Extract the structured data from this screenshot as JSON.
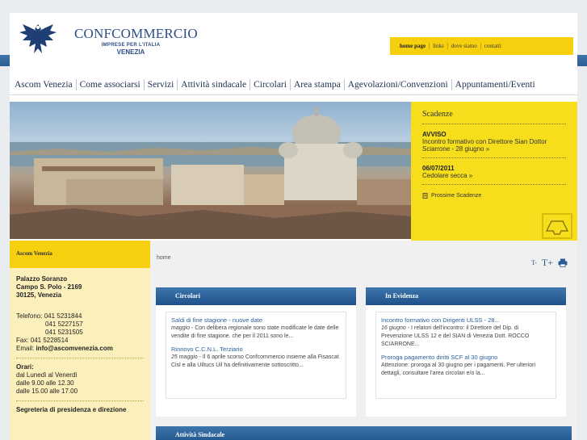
{
  "brand": {
    "name": "CONFCOMMERCIO",
    "subtitle": "IMPRESE PER L'ITALIA",
    "city": "VENEZIA"
  },
  "toplinks": [
    "home page",
    "links",
    "dove siamo",
    "contatti"
  ],
  "nav": [
    "Ascom Venezia",
    "Come associarsi",
    "Servizi",
    "Attività sindacale",
    "Circolari",
    "Area stampa",
    "Agevolazioni/Convenzioni",
    "Appuntamenti/Eventi"
  ],
  "scadenze": {
    "title": "Scadenze",
    "items": [
      {
        "date": "AVVISO",
        "text": "Incontro formativo con Direttore Sian Dottor Sciarrone - 28 giugno »"
      },
      {
        "date": "06/07/2011",
        "text": "Cedolare secca »"
      }
    ],
    "next": "Prossime Scadenze"
  },
  "sidebar": {
    "title": "Ascom Venezia",
    "address": [
      "Palazzo Soranzo",
      "Campo S. Polo - 2169",
      "30125, Venezia"
    ],
    "phone_label": "Telefono: 041 5231844",
    "phones_more": [
      "041 5227157",
      "041 5231505"
    ],
    "fax": "Fax: 041 5228514",
    "email_label": "Email: ",
    "email": "info@ascomvenezia.com",
    "hours_title": "Orari:",
    "hours": [
      "dal Lunedì al Venerdì",
      "dalle 9.00 alle 12.30",
      "dalle 15.00 alle 17.00"
    ],
    "footer": "Segreteria di presidenza e direzione"
  },
  "breadcrumb": "home",
  "tools": {
    "smaller": "T-",
    "bigger": "T+"
  },
  "circolari": {
    "title": "Circolari",
    "items": [
      {
        "title": "Saldi di fine stagione - nuove date",
        "date": "maggio",
        "text": " - Con delibera regionale sono state modificate le date delle vendite di fine stagione. che per il 2011 sono le..."
      },
      {
        "title": "Rinnovo C.C.N.L. Terziario",
        "date": "25 maggio",
        "text": " - Il 6 aprile scorso Confcommercio insieme alla Fisascat Cisl e alla Uiltucs Uil ha definitivamente sottoscritto..."
      }
    ]
  },
  "evidenza": {
    "title": "In Evidenza",
    "items": [
      {
        "title": "Incontro formativo con Dirigenti ULSS - 28...",
        "date": "16 giugno",
        "text": " - I relatori dell'incontro: il Direttore del Dip. di Prevenzione ULSS 12 e del SIAN di Venezia Dott. ROCCO SCIARRONE..."
      },
      {
        "title": "Proroga pagamento diritti SCF al 30 giugno",
        "date": "",
        "text": "Attenzione: proroga al 30 giugno per i pagamenti. Per ulteriori dettagli, consultare l'area circolari e/o la..."
      }
    ]
  },
  "attivita": {
    "title": "Attività Sindacale"
  },
  "colors": {
    "accent_yellow": "#f6cf0e",
    "nav_blue": "#2c5f94",
    "link_blue": "#2a5f9b"
  }
}
